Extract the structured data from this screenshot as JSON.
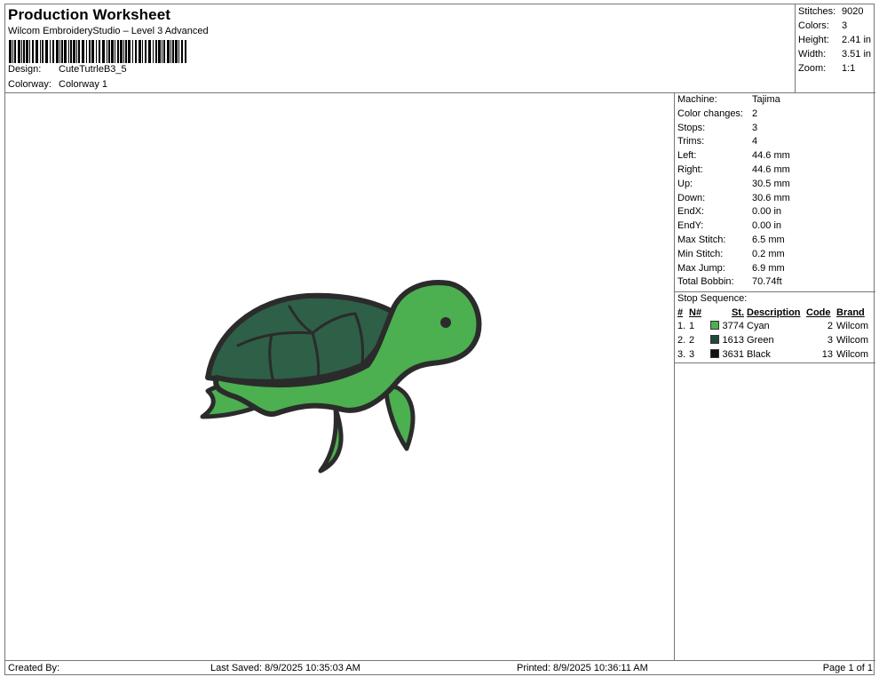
{
  "header": {
    "title": "Production Worksheet",
    "subtitle": "Wilcom EmbroideryStudio – Level 3 Advanced",
    "design_label": "Design:",
    "design_value": "CuteTutrleB3_5",
    "colorway_label": "Colorway:",
    "colorway_value": "Colorway 1"
  },
  "stats": [
    {
      "label": "Stitches:",
      "value": "9020"
    },
    {
      "label": "Colors:",
      "value": "3"
    },
    {
      "label": "Height:",
      "value": "2.41 in"
    },
    {
      "label": "Width:",
      "value": "3.51 in"
    },
    {
      "label": "Zoom:",
      "value": "1:1"
    }
  ],
  "info": [
    {
      "label": "Machine:",
      "value": "Tajima"
    },
    {
      "label": "Color changes:",
      "value": "2"
    },
    {
      "label": "Stops:",
      "value": "3"
    },
    {
      "label": "Trims:",
      "value": "4"
    },
    {
      "label": "Left:",
      "value": "44.6 mm"
    },
    {
      "label": "Right:",
      "value": "44.6 mm"
    },
    {
      "label": "Up:",
      "value": "30.5 mm"
    },
    {
      "label": "Down:",
      "value": "30.6 mm"
    },
    {
      "label": "EndX:",
      "value": "0.00 in"
    },
    {
      "label": "EndY:",
      "value": "0.00 in"
    },
    {
      "label": "Max Stitch:",
      "value": "6.5 mm"
    },
    {
      "label": "Min Stitch:",
      "value": "0.2 mm"
    },
    {
      "label": "Max Jump:",
      "value": "6.9 mm"
    },
    {
      "label": "Total Bobbin:",
      "value": "70.74ft"
    }
  ],
  "stop_sequence": {
    "title": "Stop Sequence:",
    "columns": [
      "#",
      "N#",
      "St.",
      "Description",
      "Code",
      "Brand"
    ],
    "rows": [
      {
        "index": "1.",
        "n": "1",
        "color": "#4caf50",
        "st": "3774",
        "description": "Cyan",
        "code": "2",
        "brand": "Wilcom"
      },
      {
        "index": "2.",
        "n": "2",
        "color": "#1f4a37",
        "st": "1613",
        "description": "Green",
        "code": "3",
        "brand": "Wilcom"
      },
      {
        "index": "3.",
        "n": "3",
        "color": "#111111",
        "st": "3631",
        "description": "Black",
        "code": "13",
        "brand": "Wilcom"
      }
    ]
  },
  "footer": {
    "created_by": "Created By:",
    "last_saved": "Last Saved: 8/9/2025 10:35:03 AM",
    "printed": "Printed: 8/9/2025 10:36:11 AM",
    "page": "Page 1 of 1"
  },
  "design_colors": {
    "body": "#4caf50",
    "shell": "#2e5f47",
    "outline": "#2b2b2b"
  }
}
